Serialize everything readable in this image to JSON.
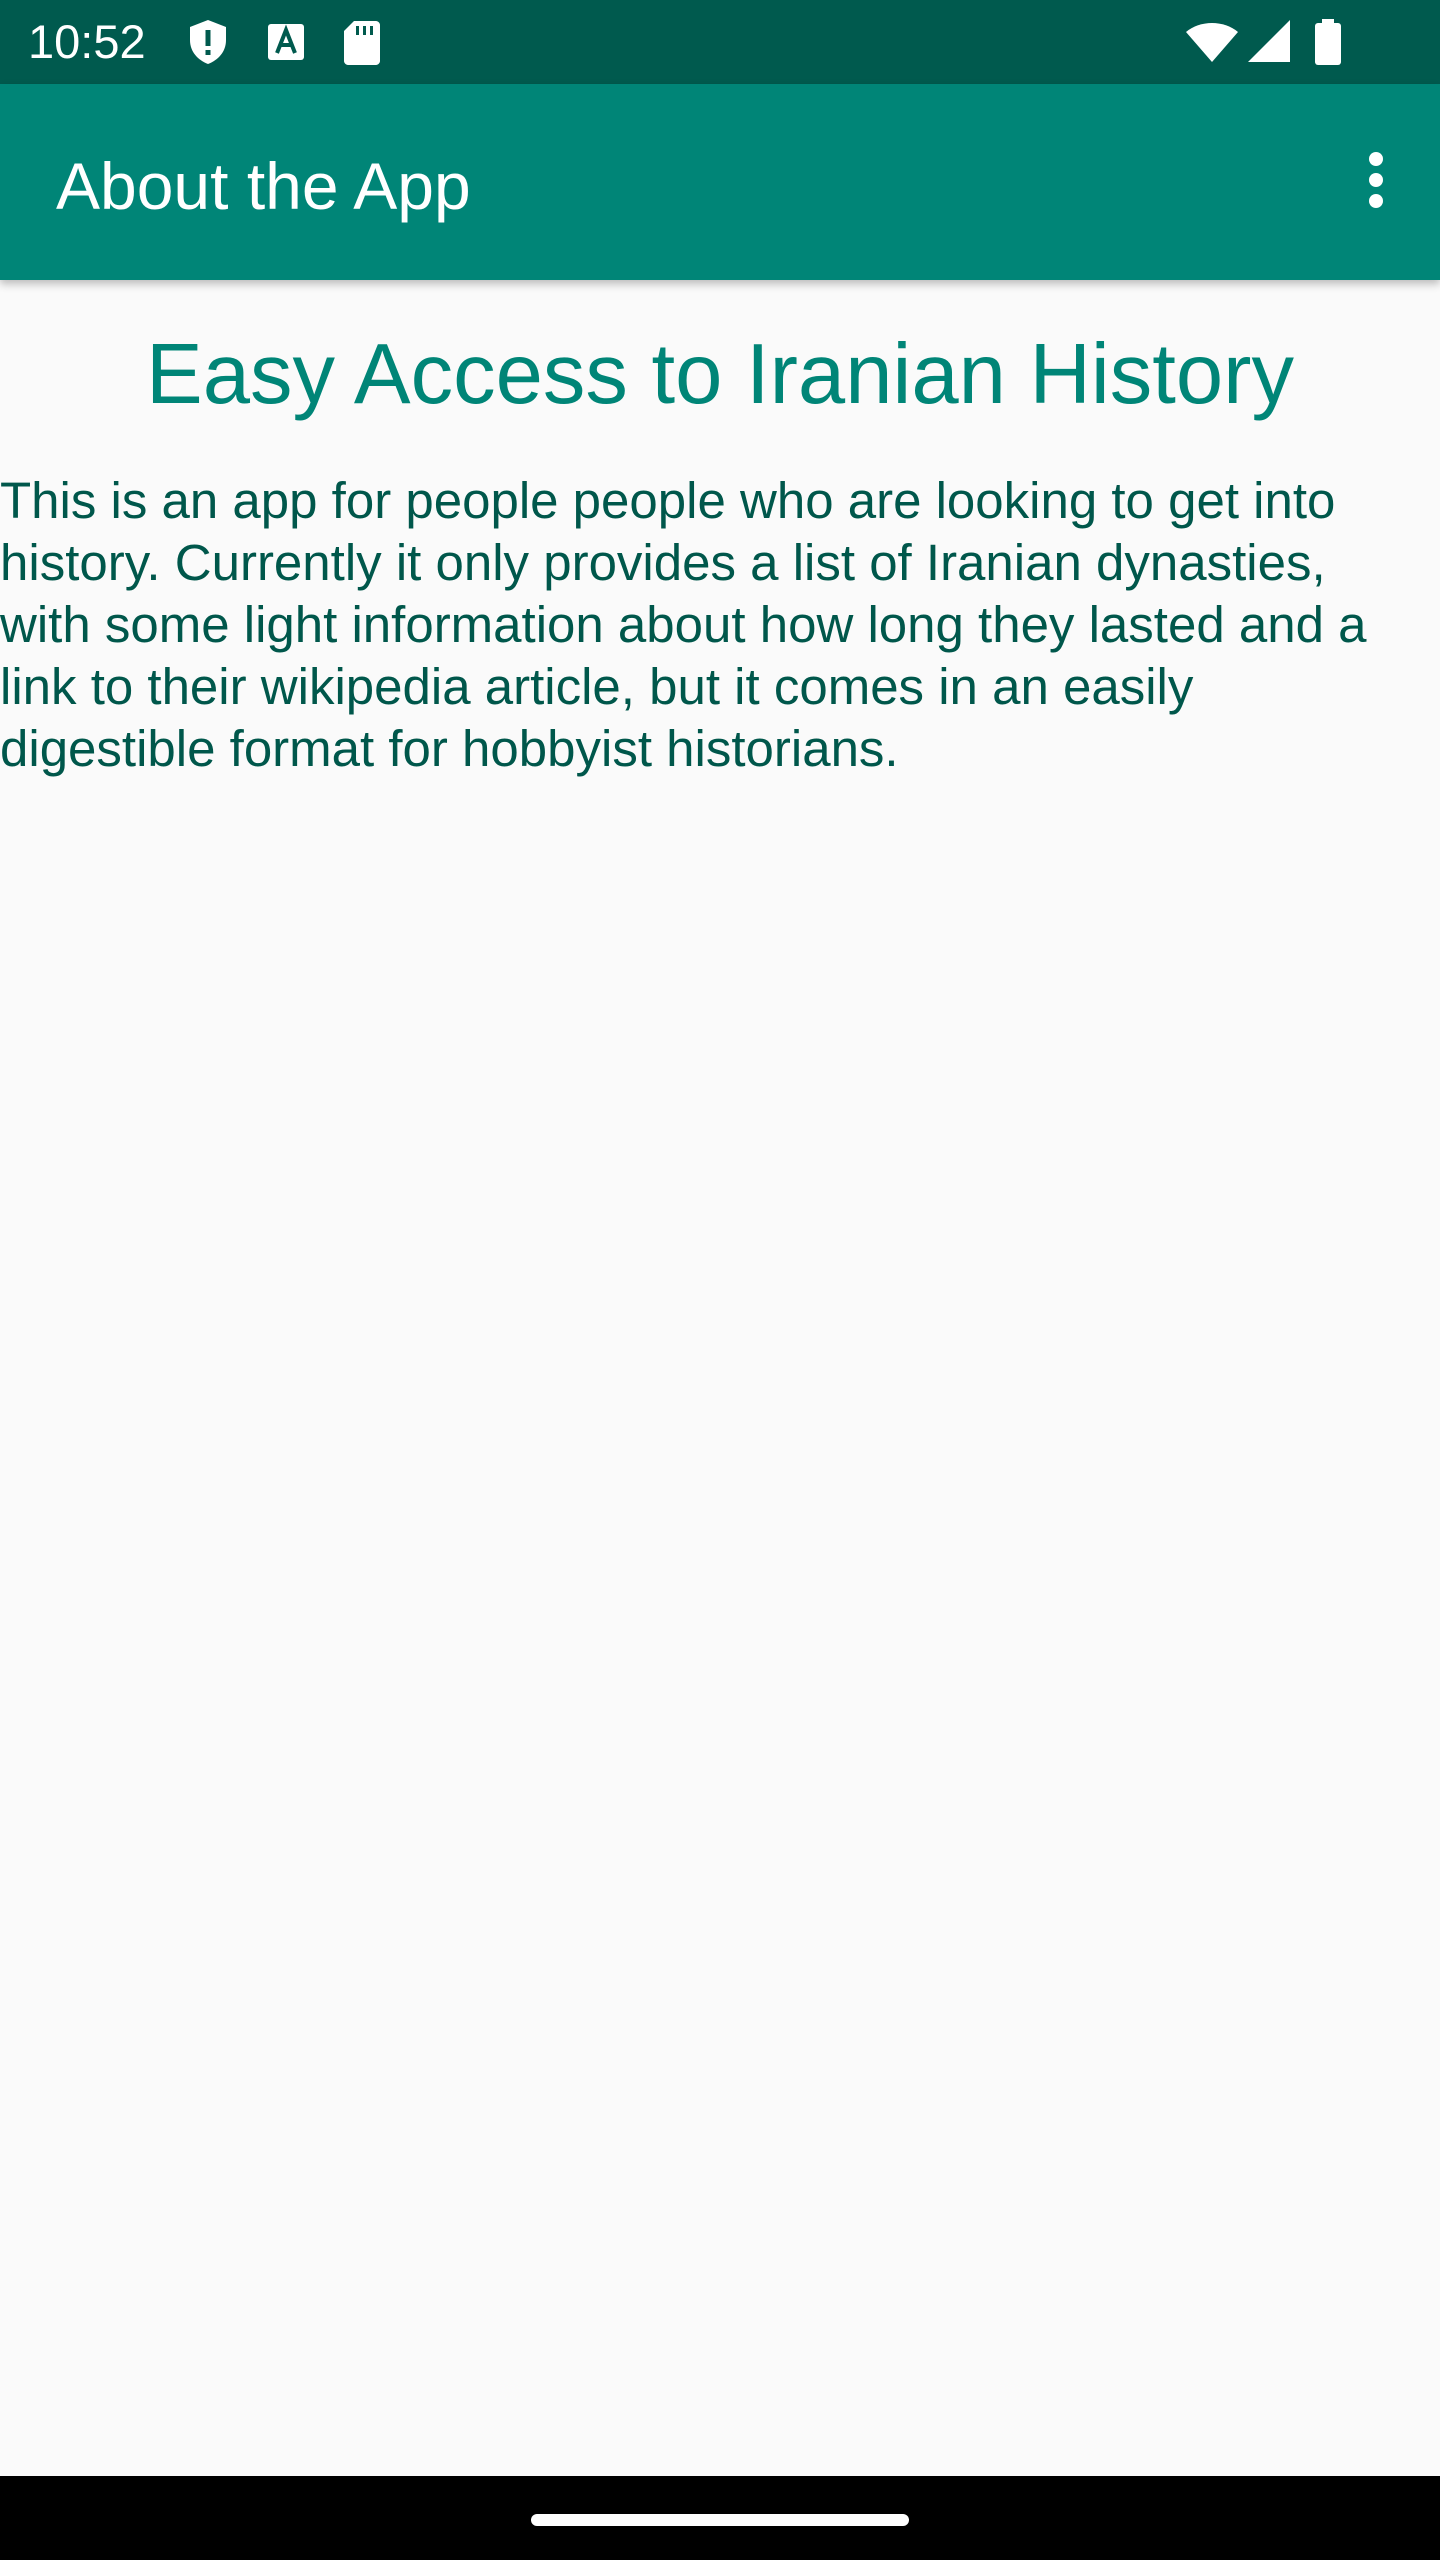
{
  "status_bar": {
    "time": "10:52",
    "left_icons": [
      "shield-alert-icon",
      "font-a-icon",
      "sd-card-icon"
    ],
    "right_icons": [
      "wifi-icon",
      "cellular-signal-icon",
      "battery-icon"
    ]
  },
  "app_bar": {
    "title": "About the App",
    "overflow_icon": "more-vert-icon",
    "background_color": "#008577"
  },
  "content": {
    "headline": "Easy Access to Iranian History",
    "description": "This is an app for people people who are looking to get into history. Currently it only provides a list of Iranian dynasties, with some light information about how long they lasted and a link to their wikipedia article, but it comes in an easily digestible format for hobbyist historians.",
    "headline_color": "#008577",
    "text_color": "#00574b"
  },
  "colors": {
    "status_bar": "#005a4e",
    "background": "#fafafa",
    "nav_bar": "#000000"
  }
}
